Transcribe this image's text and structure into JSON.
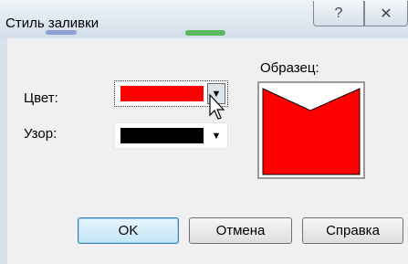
{
  "window": {
    "title": "Стиль заливки",
    "help_glyph": "?",
    "close_glyph": "✕"
  },
  "form": {
    "color_label": "Цвет:",
    "color_value": "#ff0000",
    "pattern_label": "Узор:",
    "pattern_value": "#000000",
    "dropdown_glyph": "▼"
  },
  "preview": {
    "label": "Образец:",
    "fill_color": "#ff0000"
  },
  "buttons": {
    "ok": "OK",
    "cancel": "Отмена",
    "help": "Справка"
  }
}
